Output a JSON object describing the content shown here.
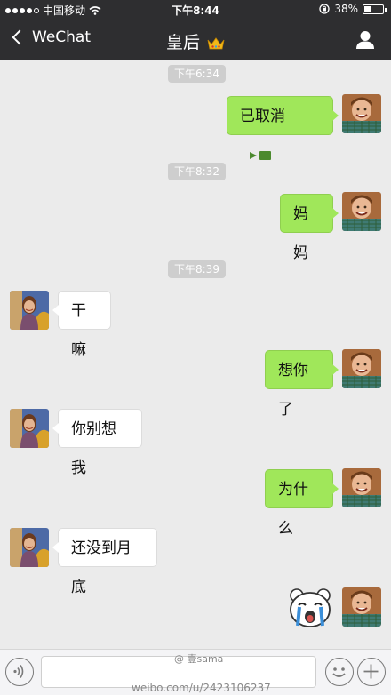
{
  "status_bar": {
    "carrier": "中国移动",
    "time": "下午8:44",
    "battery": "38%",
    "battery_level": 0.38
  },
  "nav": {
    "back_label": "WeChat",
    "title": "皇后",
    "title_emoji": "crown-emoji",
    "contact_icon": "person-icon"
  },
  "chat": {
    "timestamps": [
      "下午6:34",
      "下午8:32",
      "下午8:39"
    ],
    "messages": [
      {
        "sender": "me",
        "text": "已取消",
        "icon": "video-call-icon"
      },
      {
        "sender": "me",
        "text": "妈妈"
      },
      {
        "sender": "them",
        "text": "干嘛"
      },
      {
        "sender": "me",
        "text": "想你了"
      },
      {
        "sender": "them",
        "text": "你别想我"
      },
      {
        "sender": "me",
        "text": "为什么"
      },
      {
        "sender": "them",
        "text": "还没到月底"
      },
      {
        "sender": "me",
        "sticker": "crying-bear-sticker"
      }
    ]
  },
  "input_bar": {
    "voice_icon": "voice-icon",
    "emoji_icon": "emoji-icon",
    "plus_icon": "plus-icon"
  },
  "watermark": {
    "line1": "@ 壹sama",
    "line2": "weibo.com/u/2423106237"
  }
}
